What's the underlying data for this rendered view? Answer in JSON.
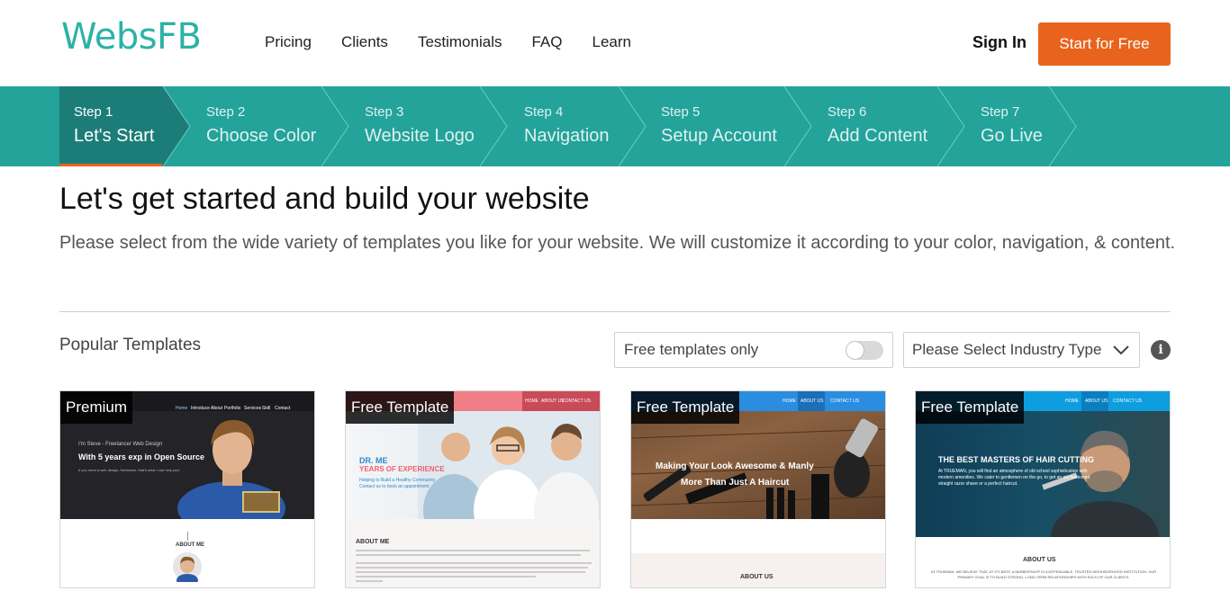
{
  "brand": {
    "logo": "WebsFB"
  },
  "nav": {
    "items": [
      "Pricing",
      "Clients",
      "Testimonials",
      "FAQ",
      "Learn"
    ]
  },
  "header": {
    "signin": "Sign In",
    "cta": "Start for Free"
  },
  "steps": [
    {
      "num": "Step 1",
      "name": "Let's Start",
      "active": true
    },
    {
      "num": "Step 2",
      "name": "Choose Color"
    },
    {
      "num": "Step 3",
      "name": "Website Logo"
    },
    {
      "num": "Step 4",
      "name": "Navigation"
    },
    {
      "num": "Step 5",
      "name": "Setup Account"
    },
    {
      "num": "Step 6",
      "name": "Add Content"
    },
    {
      "num": "Step 7",
      "name": "Go Live"
    }
  ],
  "main": {
    "title": "Let's get started and build your website",
    "lead": "Please select from the wide variety of templates you like for your website. We will customize it according to your color, navigation, & content.",
    "section_label": "Popular Templates",
    "free_toggle_label": "Free templates only",
    "free_toggle_on": false,
    "industry_select": "Please Select Industry Type",
    "info_icon": "i"
  },
  "templates": [
    {
      "badge": "Premium",
      "nav_items": [
        "Home",
        "Introduce",
        "About",
        "Portfolio",
        "Services",
        "Skill",
        "Contact"
      ],
      "intro_small": "I'm Steve - Freelancer Web Design",
      "headline": "With 5 years exp in Open Source",
      "sub": "If you need a web design, freelancer, that's what I can help you!",
      "section": "ABOUT ME"
    },
    {
      "badge": "Free Template",
      "nav_items": [
        "HOME",
        "ABOUT US",
        "CONTACT US"
      ],
      "name": "DR. ME",
      "headline": "YEARS OF EXPERIENCE",
      "sub1": "Helping to Build a Healthy Community",
      "sub2": "Contact us to book an appointment",
      "section": "ABOUT ME"
    },
    {
      "badge": "Free Template",
      "nav_items": [
        "HOME",
        "ABOUT US",
        "CONTACT US"
      ],
      "headline1": "Making Your Look Awesome & Manly",
      "headline2": "More Than Just A Haircut",
      "section": "ABOUT US"
    },
    {
      "badge": "Free Template",
      "nav_items": [
        "HOME",
        "ABOUT US",
        "CONTACT US"
      ],
      "headline": "THE BEST MASTERS OF HAIR CUTTING",
      "sub": "At TRUEMAN, you will find an atmosphere of old school sophistication with modern amenities. We cater to gentlemen on the go, to get an old fashioned straight razor shave or a perfect haircut.",
      "section": "ABOUT US",
      "body": "AT TRUEMAN, WE BELIEVE THAT, AT ITS BEST, A BARBERSHOP IS A DEPENDABLE, TRUSTED NEIGHBORHOOD INSTITUTION. OUR PRIMARY GOAL IS TO BUILD STRONG, LONG-TERM RELATIONSHIPS WITH EACH OF OUR CLIENTS."
    }
  ],
  "colors": {
    "teal": "#23a39a",
    "teal_dark": "#1c7d78",
    "accent": "#e8641e"
  }
}
